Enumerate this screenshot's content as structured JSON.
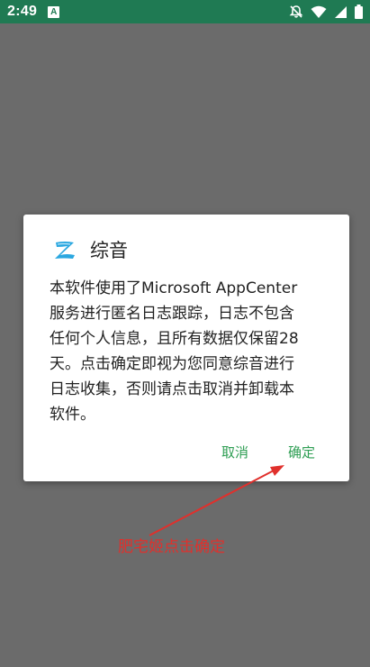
{
  "status_bar": {
    "time": "2:49",
    "app_badge": "A",
    "icons": [
      "mute-bell-icon",
      "wifi-icon",
      "signal-icon",
      "battery-icon"
    ]
  },
  "dialog": {
    "logo_icon": "zongyin-logo-icon",
    "title": "综音",
    "message_lines": [
      "本软件使用了Microsoft AppCenter",
      "服务进行匿名日志跟踪，日志不包含",
      "任何个人信息，且所有数据仅保留28",
      "天。点击确定即视为您同意综音进行",
      "日志收集，否则请点击取消并卸载本",
      "软件。"
    ],
    "cancel_label": "取消",
    "ok_label": "确定"
  },
  "annotation": {
    "text": "肥宅姬点击确定"
  },
  "colors": {
    "status_bar": "#1f7a53",
    "scrim": "#6b6b6b",
    "accent_button": "#2e9e53",
    "annotation": "#e0302c",
    "logo_blue": "#2aa7e0"
  }
}
